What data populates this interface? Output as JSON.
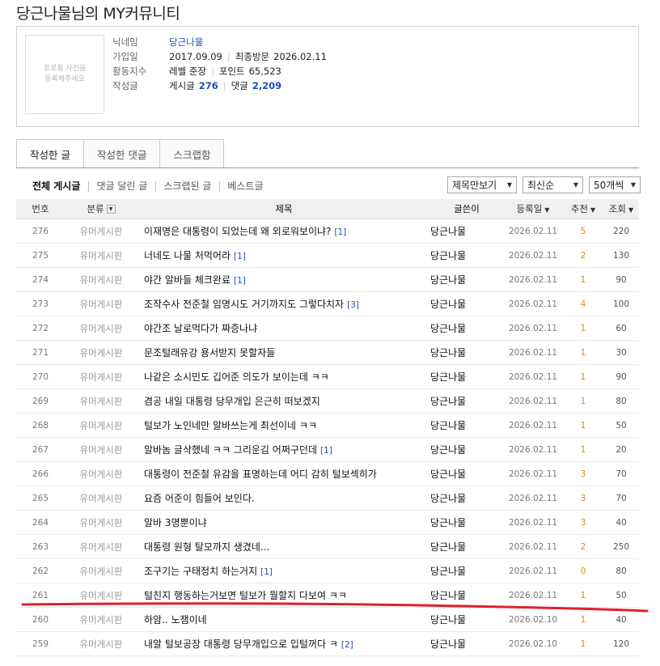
{
  "page": {
    "title": "당근나물님의 MY커뮤니티"
  },
  "profile": {
    "photo_placeholder": "프로필 사진을\n등록해주세요",
    "nickname_label": "닉네임",
    "nickname": "당근나물",
    "joined_label": "가입일",
    "joined": "2017.09.09",
    "last_visit_label": "최종방문",
    "last_visit": "2026.02.11",
    "activity_label": "활동지수",
    "level": "레벨 준장",
    "points_label": "포인트",
    "points": "65,523",
    "posts_label": "작성글",
    "post_count_label": "게시글",
    "post_count": "276",
    "comment_count_label": "댓글",
    "comment_count": "2,209"
  },
  "tabs": [
    {
      "label": "작성한 글",
      "active": true
    },
    {
      "label": "작성한 댓글",
      "active": false
    },
    {
      "label": "스크랩함",
      "active": false
    }
  ],
  "filters": {
    "items": [
      "전체 게시글",
      "댓글 달린 글",
      "스크랩된 글",
      "베스트글"
    ],
    "view_select": "제목만보기",
    "sort_select": "최신순",
    "count_select": "50개씩"
  },
  "table": {
    "headers": {
      "num": "번호",
      "category": "분류",
      "title": "제목",
      "writer": "글쓴이",
      "date": "등록일",
      "rec": "추천",
      "views": "조회"
    },
    "rows": [
      {
        "num": "276",
        "category": "유머게시판",
        "title": "이재명은 대통령이 되었는데 왜 외로워보이냐?",
        "comments": "[1]",
        "writer": "당근나물",
        "date": "2026.02.11",
        "rec": "5",
        "views": "220"
      },
      {
        "num": "275",
        "category": "유머게시판",
        "title": "너네도 나물 처먹어라",
        "comments": "[1]",
        "writer": "당근나물",
        "date": "2026.02.11",
        "rec": "2",
        "views": "130"
      },
      {
        "num": "274",
        "category": "유머게시판",
        "title": "야간 알바들 체크완료",
        "comments": "[1]",
        "writer": "당근나물",
        "date": "2026.02.11",
        "rec": "1",
        "views": "90"
      },
      {
        "num": "273",
        "category": "유머게시판",
        "title": "조작수사 전준철 임명시도 거기까지도 그렇다치자",
        "comments": "[3]",
        "writer": "당근나물",
        "date": "2026.02.11",
        "rec": "4",
        "views": "100"
      },
      {
        "num": "272",
        "category": "유머게시판",
        "title": "야간조 날로먹다가 짜증나냐",
        "comments": "",
        "writer": "당근나물",
        "date": "2026.02.11",
        "rec": "1",
        "views": "60"
      },
      {
        "num": "271",
        "category": "유머게시판",
        "title": "문조털래유강 용서받지 못할자들",
        "comments": "",
        "writer": "당근나물",
        "date": "2026.02.11",
        "rec": "1",
        "views": "30"
      },
      {
        "num": "270",
        "category": "유머게시판",
        "title": "나같은 소시민도 깁어준 의도가 보이는데 ㅋㅋ",
        "comments": "",
        "writer": "당근나물",
        "date": "2026.02.11",
        "rec": "1",
        "views": "90"
      },
      {
        "num": "269",
        "category": "유머게시판",
        "title": "겸공 내일 대통령 당무개입 은근히 떠보겠지",
        "comments": "",
        "writer": "당근나물",
        "date": "2026.02.11",
        "rec": "1",
        "views": "80"
      },
      {
        "num": "268",
        "category": "유머게시판",
        "title": "털보가 노인네만 알바쓰는게 최선이네 ㅋㅋ",
        "comments": "",
        "writer": "당근나물",
        "date": "2026.02.11",
        "rec": "1",
        "views": "50"
      },
      {
        "num": "267",
        "category": "유머게시판",
        "title": "알바놈 글삭했네 ㅋㅋ 그리운김 어쩌구던데",
        "comments": "[1]",
        "writer": "당근나물",
        "date": "2026.02.11",
        "rec": "1",
        "views": "20"
      },
      {
        "num": "266",
        "category": "유머게시판",
        "title": "대통령이 전준철 유감을 표명하는데 어디 감히 털보섹히가",
        "comments": "",
        "writer": "당근나물",
        "date": "2026.02.11",
        "rec": "3",
        "views": "70"
      },
      {
        "num": "265",
        "category": "유머게시판",
        "title": "요즘 어준이 힘들어 보인다.",
        "comments": "",
        "writer": "당근나물",
        "date": "2026.02.11",
        "rec": "3",
        "views": "70"
      },
      {
        "num": "264",
        "category": "유머게시판",
        "title": "알바 3명뿐이냐",
        "comments": "",
        "writer": "당근나물",
        "date": "2026.02.11",
        "rec": "3",
        "views": "40"
      },
      {
        "num": "263",
        "category": "유머게시판",
        "title": "대통령 원형 탈모까지 생겼네...",
        "comments": "",
        "writer": "당근나물",
        "date": "2026.02.11",
        "rec": "2",
        "views": "250"
      },
      {
        "num": "262",
        "category": "유머게시판",
        "title": "조구기는 구태정치 하는거지",
        "comments": "[1]",
        "writer": "당근나물",
        "date": "2026.02.11",
        "rec": "0",
        "views": "80"
      },
      {
        "num": "261",
        "category": "유머게시판",
        "title": "털친지 행동하는거보면 털보가 뭘할지 다보여 ㅋㅋ",
        "comments": "",
        "writer": "당근나물",
        "date": "2026.02.11",
        "rec": "1",
        "views": "50"
      },
      {
        "num": "260",
        "category": "유머게시판",
        "title": "하암.. 노잼이네",
        "comments": "",
        "writer": "당근나물",
        "date": "2026.02.10",
        "rec": "1",
        "views": "40"
      },
      {
        "num": "259",
        "category": "유머게시판",
        "title": "내알 털보공장 대통령 당무개입으로 입털꺼다 ㅋ",
        "comments": "[2]",
        "writer": "당근나물",
        "date": "2026.02.10",
        "rec": "1",
        "views": "120"
      }
    ]
  },
  "colors": {
    "accent_blue": "#1f4fb5",
    "recommend_orange": "#e08a0a",
    "annotation_red": "#e0202a"
  }
}
